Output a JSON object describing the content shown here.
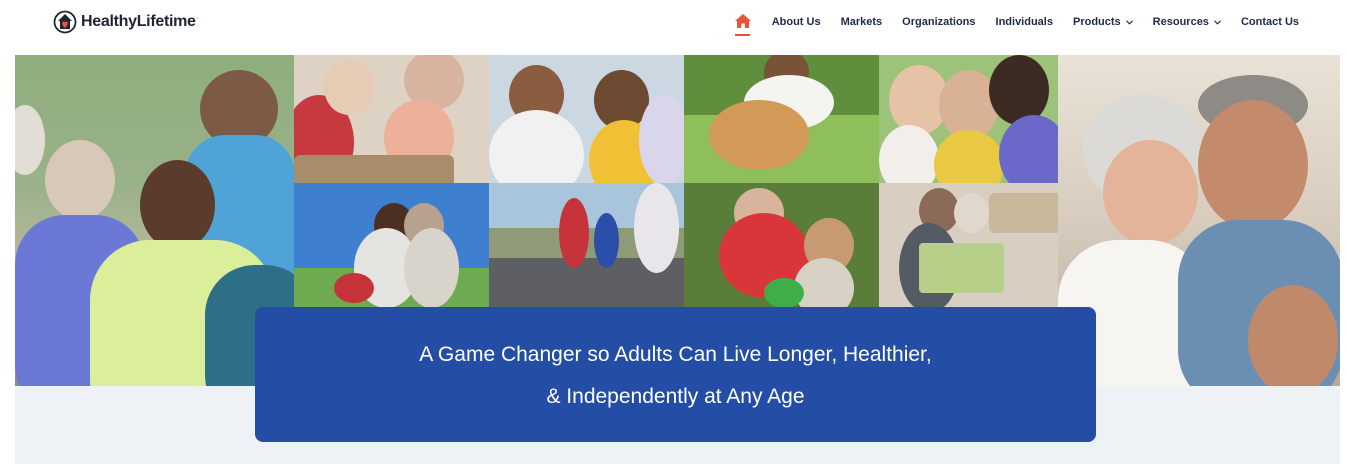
{
  "brand": {
    "name": "HealthyLifetime",
    "tm": "·"
  },
  "nav": {
    "items": [
      {
        "label": "About Us",
        "dropdown": false
      },
      {
        "label": "Markets",
        "dropdown": false
      },
      {
        "label": "Organizations",
        "dropdown": false
      },
      {
        "label": "Individuals",
        "dropdown": false
      },
      {
        "label": "Products",
        "dropdown": true
      },
      {
        "label": "Resources",
        "dropdown": true
      },
      {
        "label": "Contact Us",
        "dropdown": false
      }
    ],
    "home_icon": "home-icon",
    "accent": "#e8533a"
  },
  "hero": {
    "headline_line1": "A Game Changer so Adults Can Live Longer, Healthier,",
    "headline_line2": "& Independently at Any Age",
    "banner_color": "#244ea5"
  },
  "colors": {
    "nav_text": "#1c2b4a",
    "brand_text": "#1f2530",
    "band": "#eef2f7"
  }
}
